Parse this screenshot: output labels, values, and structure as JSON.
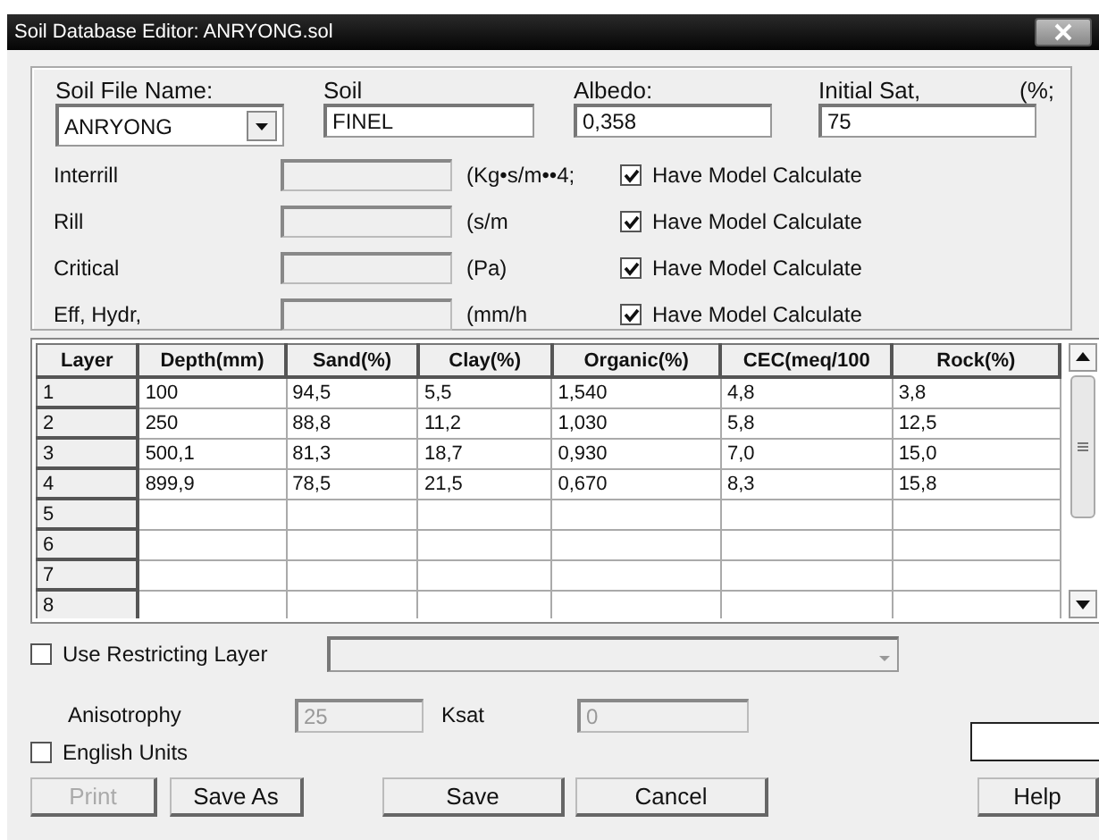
{
  "window": {
    "title": "Soil Database Editor: ANRYONG.sol"
  },
  "soil": {
    "file_name_label": "Soil File Name:",
    "file_name": "ANRYONG",
    "soil_label": "Soil",
    "soil": "FINEL",
    "albedo_label": "Albedo:",
    "albedo": "0,358",
    "initial_sat_label": "Initial Sat,",
    "initial_sat_unit": "(%;",
    "initial_sat": "75"
  },
  "parameters": [
    {
      "label": "Interrill",
      "unit": "(Kg•s/m••4;",
      "model_label": "Have Model Calculate",
      "checked": true
    },
    {
      "label": "Rill",
      "unit": "(s/m",
      "model_label": "Have Model Calculate",
      "checked": true
    },
    {
      "label": "Critical",
      "unit": "(Pa)",
      "model_label": "Have Model Calculate",
      "checked": true
    },
    {
      "label": "Eff, Hydr,",
      "unit": "(mm/h",
      "model_label": "Have Model Calculate",
      "checked": true
    }
  ],
  "table": {
    "columns": [
      "Layer",
      "Depth(mm)",
      "Sand(%)",
      "Clay(%)",
      "Organic(%)",
      "CEC(meq/100",
      "Rock(%)"
    ],
    "rows": [
      {
        "layer": "1",
        "cells": [
          "100",
          "94,5",
          "5,5",
          "1,540",
          "4,8",
          "3,8"
        ]
      },
      {
        "layer": "2",
        "cells": [
          "250",
          "88,8",
          "11,2",
          "1,030",
          "5,8",
          "12,5"
        ]
      },
      {
        "layer": "3",
        "cells": [
          "500,1",
          "81,3",
          "18,7",
          "0,930",
          "7,0",
          "15,0"
        ]
      },
      {
        "layer": "4",
        "cells": [
          "899,9",
          "78,5",
          "21,5",
          "0,670",
          "8,3",
          "15,8"
        ]
      },
      {
        "layer": "5"
      },
      {
        "layer": "6"
      },
      {
        "layer": "7"
      },
      {
        "layer": "8"
      }
    ]
  },
  "restricting_layer": {
    "label": "Use Restricting Layer",
    "checked": false,
    "combo_disabled": true
  },
  "anisotrophy": {
    "label": "Anisotrophy",
    "value": "25",
    "disabled": true
  },
  "ksat": {
    "label": "Ksat",
    "value": "0",
    "disabled": true
  },
  "english_units": {
    "label": "English Units",
    "checked": false
  },
  "buttons": [
    {
      "label": "Print",
      "disabled": true
    },
    {
      "label": "Save As",
      "disabled": false
    },
    {
      "label": "Save",
      "disabled": false
    },
    {
      "label": "Cancel",
      "disabled": false
    },
    {
      "label": "Help",
      "disabled": false
    }
  ]
}
